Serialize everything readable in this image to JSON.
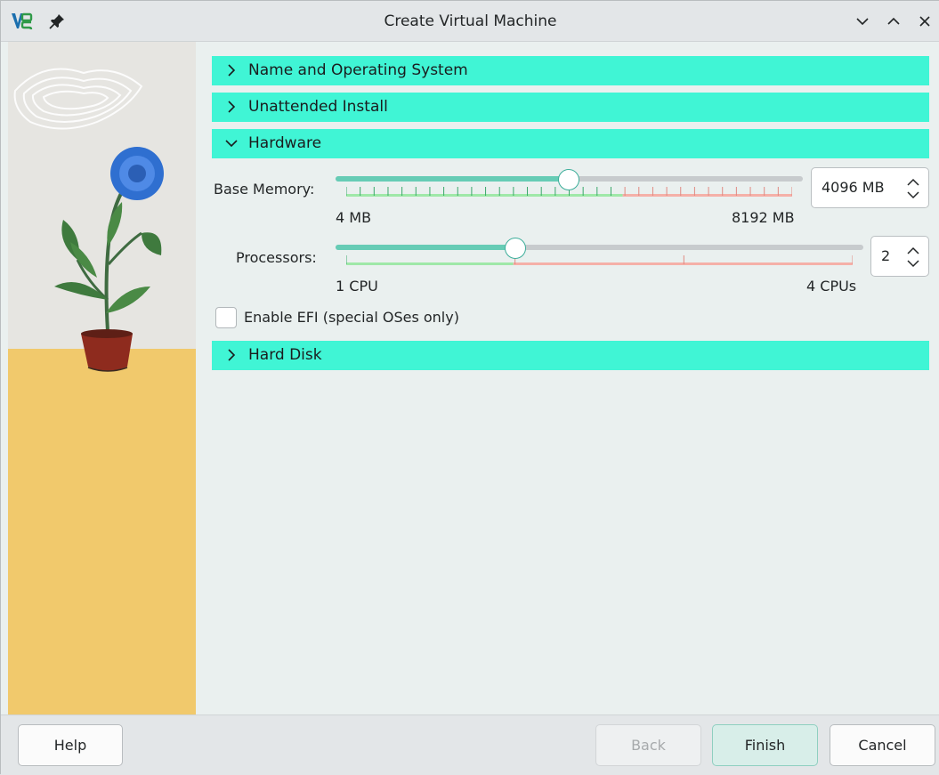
{
  "window": {
    "title": "Create Virtual Machine"
  },
  "sections": {
    "name_os": "Name and Operating System",
    "unattended": "Unattended Install",
    "hardware": "Hardware",
    "hard_disk": "Hard Disk"
  },
  "hardware": {
    "memory": {
      "label": "Base Memory:",
      "min_label": "4 MB",
      "max_label": "8192 MB",
      "value_text": "4096 MB",
      "value_mb": 4096,
      "min_mb": 4,
      "max_mb": 8192
    },
    "processors": {
      "label": "Processors:",
      "min_label": "1 CPU",
      "max_label": "4 CPUs",
      "value_text": "2",
      "value": 2,
      "min": 1,
      "max": 4
    },
    "efi": {
      "label": "Enable EFI (special OSes only)",
      "checked": false
    }
  },
  "buttons": {
    "help": "Help",
    "back": "Back",
    "finish": "Finish",
    "cancel": "Cancel"
  },
  "colors": {
    "accent": "#40f5d5",
    "slider_fill": "#66ccb5",
    "safe_zone": "#9fe8a8",
    "danger_zone": "#f5b0a8"
  },
  "icons": {
    "app": "virtualbox-icon",
    "pin": "pin-icon",
    "minimize": "chevron-down-icon",
    "maximize": "chevron-up-icon",
    "close": "close-icon"
  }
}
